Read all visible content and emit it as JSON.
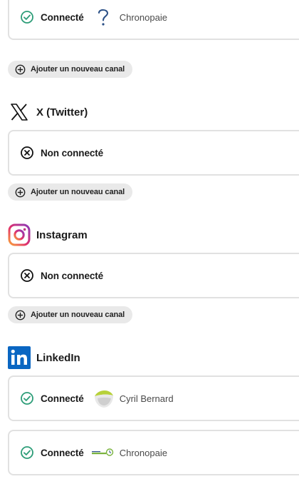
{
  "colors": {
    "connected_green": "#2d9d78",
    "border": "#e1e1e1",
    "button_bg": "#e9e9e9",
    "linkedin_blue": "#0a66c2"
  },
  "add_channel_label": "Ajouter un nouveau canal",
  "sections": [
    {
      "accounts": [
        {
          "status": "Connecté",
          "status_icon": "check-circle-icon",
          "logo": "question-mark-icon",
          "name": "Chronopaie"
        }
      ]
    },
    {
      "title": "X (Twitter)",
      "brand_icon": "x-logo-icon",
      "accounts": [
        {
          "status": "Non connecté",
          "status_icon": "x-circle-icon"
        }
      ]
    },
    {
      "title": "Instagram",
      "brand_icon": "instagram-logo-icon",
      "accounts": [
        {
          "status": "Non connecté",
          "status_icon": "x-circle-icon"
        }
      ]
    },
    {
      "title": "LinkedIn",
      "brand_icon": "linkedin-logo-icon",
      "accounts": [
        {
          "status": "Connecté",
          "status_icon": "check-circle-icon",
          "logo": "cyril-bernard-avatar",
          "name": "Cyril Bernard"
        },
        {
          "status": "Connecté",
          "status_icon": "check-circle-icon",
          "logo": "chronopaie-logo",
          "name": "Chronopaie"
        }
      ]
    }
  ]
}
